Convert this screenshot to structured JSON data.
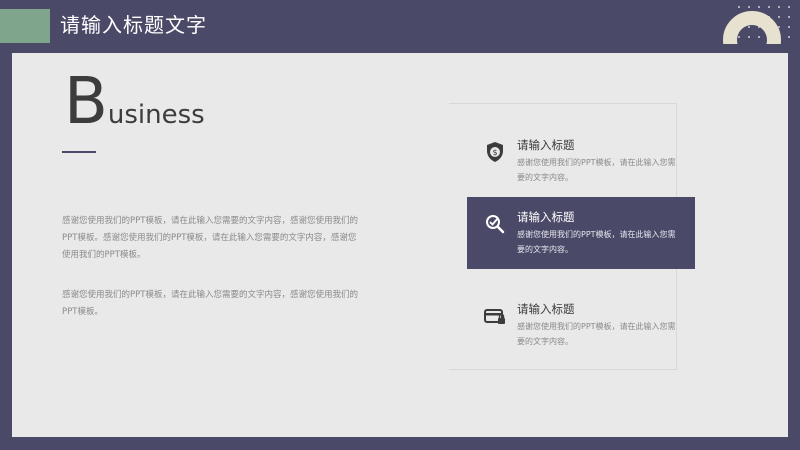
{
  "header": {
    "title": "请输入标题文字"
  },
  "business": {
    "big_letter": "B",
    "rest": "usiness"
  },
  "paragraphs": [
    "感谢您使用我们的PPT模板，请在此输入您需要的文字内容，感谢您使用我们的PPT模板。感谢您使用我们的PPT模板，请在此输入您需要的文字内容，感谢您使用我们的PPT模板。",
    "感谢您使用我们的PPT模板，请在此输入您需要的文字内容，感谢您使用我们的PPT模板。"
  ],
  "items": [
    {
      "title": "请输入标题",
      "desc": "感谢您使用我们的PPT模板，请在此输入您需要的文字内容。",
      "icon": "shield-dollar-icon",
      "active": false
    },
    {
      "title": "请输入标题",
      "desc": "感谢您使用我们的PPT模板，请在此输入您需要的文字内容。",
      "icon": "magnifier-check-icon",
      "active": true
    },
    {
      "title": "请输入标题",
      "desc": "感谢您使用我们的PPT模板，请在此输入您需要的文字内容。",
      "icon": "card-lock-icon",
      "active": false
    }
  ],
  "colors": {
    "accent": "#4a4a68",
    "green": "#7fa58c",
    "panel": "#e9e9e9",
    "arch": "#e7e2cf"
  }
}
